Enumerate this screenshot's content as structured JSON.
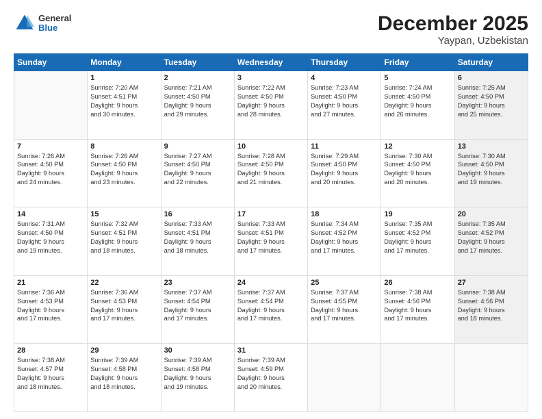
{
  "header": {
    "logo_general": "General",
    "logo_blue": "Blue",
    "title": "December 2025",
    "subtitle": "Yaypan, Uzbekistan"
  },
  "days_of_week": [
    "Sunday",
    "Monday",
    "Tuesday",
    "Wednesday",
    "Thursday",
    "Friday",
    "Saturday"
  ],
  "weeks": [
    [
      {
        "day": "",
        "info": "",
        "empty": true
      },
      {
        "day": "1",
        "info": "Sunrise: 7:20 AM\nSunset: 4:51 PM\nDaylight: 9 hours\nand 30 minutes."
      },
      {
        "day": "2",
        "info": "Sunrise: 7:21 AM\nSunset: 4:50 PM\nDaylight: 9 hours\nand 29 minutes."
      },
      {
        "day": "3",
        "info": "Sunrise: 7:22 AM\nSunset: 4:50 PM\nDaylight: 9 hours\nand 28 minutes."
      },
      {
        "day": "4",
        "info": "Sunrise: 7:23 AM\nSunset: 4:50 PM\nDaylight: 9 hours\nand 27 minutes."
      },
      {
        "day": "5",
        "info": "Sunrise: 7:24 AM\nSunset: 4:50 PM\nDaylight: 9 hours\nand 26 minutes."
      },
      {
        "day": "6",
        "info": "Sunrise: 7:25 AM\nSunset: 4:50 PM\nDaylight: 9 hours\nand 25 minutes.",
        "shaded": true
      }
    ],
    [
      {
        "day": "7",
        "info": "Sunrise: 7:26 AM\nSunset: 4:50 PM\nDaylight: 9 hours\nand 24 minutes."
      },
      {
        "day": "8",
        "info": "Sunrise: 7:26 AM\nSunset: 4:50 PM\nDaylight: 9 hours\nand 23 minutes."
      },
      {
        "day": "9",
        "info": "Sunrise: 7:27 AM\nSunset: 4:50 PM\nDaylight: 9 hours\nand 22 minutes."
      },
      {
        "day": "10",
        "info": "Sunrise: 7:28 AM\nSunset: 4:50 PM\nDaylight: 9 hours\nand 21 minutes."
      },
      {
        "day": "11",
        "info": "Sunrise: 7:29 AM\nSunset: 4:50 PM\nDaylight: 9 hours\nand 20 minutes."
      },
      {
        "day": "12",
        "info": "Sunrise: 7:30 AM\nSunset: 4:50 PM\nDaylight: 9 hours\nand 20 minutes."
      },
      {
        "day": "13",
        "info": "Sunrise: 7:30 AM\nSunset: 4:50 PM\nDaylight: 9 hours\nand 19 minutes.",
        "shaded": true
      }
    ],
    [
      {
        "day": "14",
        "info": "Sunrise: 7:31 AM\nSunset: 4:50 PM\nDaylight: 9 hours\nand 19 minutes."
      },
      {
        "day": "15",
        "info": "Sunrise: 7:32 AM\nSunset: 4:51 PM\nDaylight: 9 hours\nand 18 minutes."
      },
      {
        "day": "16",
        "info": "Sunrise: 7:33 AM\nSunset: 4:51 PM\nDaylight: 9 hours\nand 18 minutes."
      },
      {
        "day": "17",
        "info": "Sunrise: 7:33 AM\nSunset: 4:51 PM\nDaylight: 9 hours\nand 17 minutes."
      },
      {
        "day": "18",
        "info": "Sunrise: 7:34 AM\nSunset: 4:52 PM\nDaylight: 9 hours\nand 17 minutes."
      },
      {
        "day": "19",
        "info": "Sunrise: 7:35 AM\nSunset: 4:52 PM\nDaylight: 9 hours\nand 17 minutes."
      },
      {
        "day": "20",
        "info": "Sunrise: 7:35 AM\nSunset: 4:52 PM\nDaylight: 9 hours\nand 17 minutes.",
        "shaded": true
      }
    ],
    [
      {
        "day": "21",
        "info": "Sunrise: 7:36 AM\nSunset: 4:53 PM\nDaylight: 9 hours\nand 17 minutes."
      },
      {
        "day": "22",
        "info": "Sunrise: 7:36 AM\nSunset: 4:53 PM\nDaylight: 9 hours\nand 17 minutes."
      },
      {
        "day": "23",
        "info": "Sunrise: 7:37 AM\nSunset: 4:54 PM\nDaylight: 9 hours\nand 17 minutes."
      },
      {
        "day": "24",
        "info": "Sunrise: 7:37 AM\nSunset: 4:54 PM\nDaylight: 9 hours\nand 17 minutes."
      },
      {
        "day": "25",
        "info": "Sunrise: 7:37 AM\nSunset: 4:55 PM\nDaylight: 9 hours\nand 17 minutes."
      },
      {
        "day": "26",
        "info": "Sunrise: 7:38 AM\nSunset: 4:56 PM\nDaylight: 9 hours\nand 17 minutes."
      },
      {
        "day": "27",
        "info": "Sunrise: 7:38 AM\nSunset: 4:56 PM\nDaylight: 9 hours\nand 18 minutes.",
        "shaded": true
      }
    ],
    [
      {
        "day": "28",
        "info": "Sunrise: 7:38 AM\nSunset: 4:57 PM\nDaylight: 9 hours\nand 18 minutes."
      },
      {
        "day": "29",
        "info": "Sunrise: 7:39 AM\nSunset: 4:58 PM\nDaylight: 9 hours\nand 18 minutes."
      },
      {
        "day": "30",
        "info": "Sunrise: 7:39 AM\nSunset: 4:58 PM\nDaylight: 9 hours\nand 19 minutes."
      },
      {
        "day": "31",
        "info": "Sunrise: 7:39 AM\nSunset: 4:59 PM\nDaylight: 9 hours\nand 20 minutes."
      },
      {
        "day": "",
        "info": "",
        "empty": true
      },
      {
        "day": "",
        "info": "",
        "empty": true
      },
      {
        "day": "",
        "info": "",
        "empty": true,
        "shaded": true
      }
    ]
  ]
}
